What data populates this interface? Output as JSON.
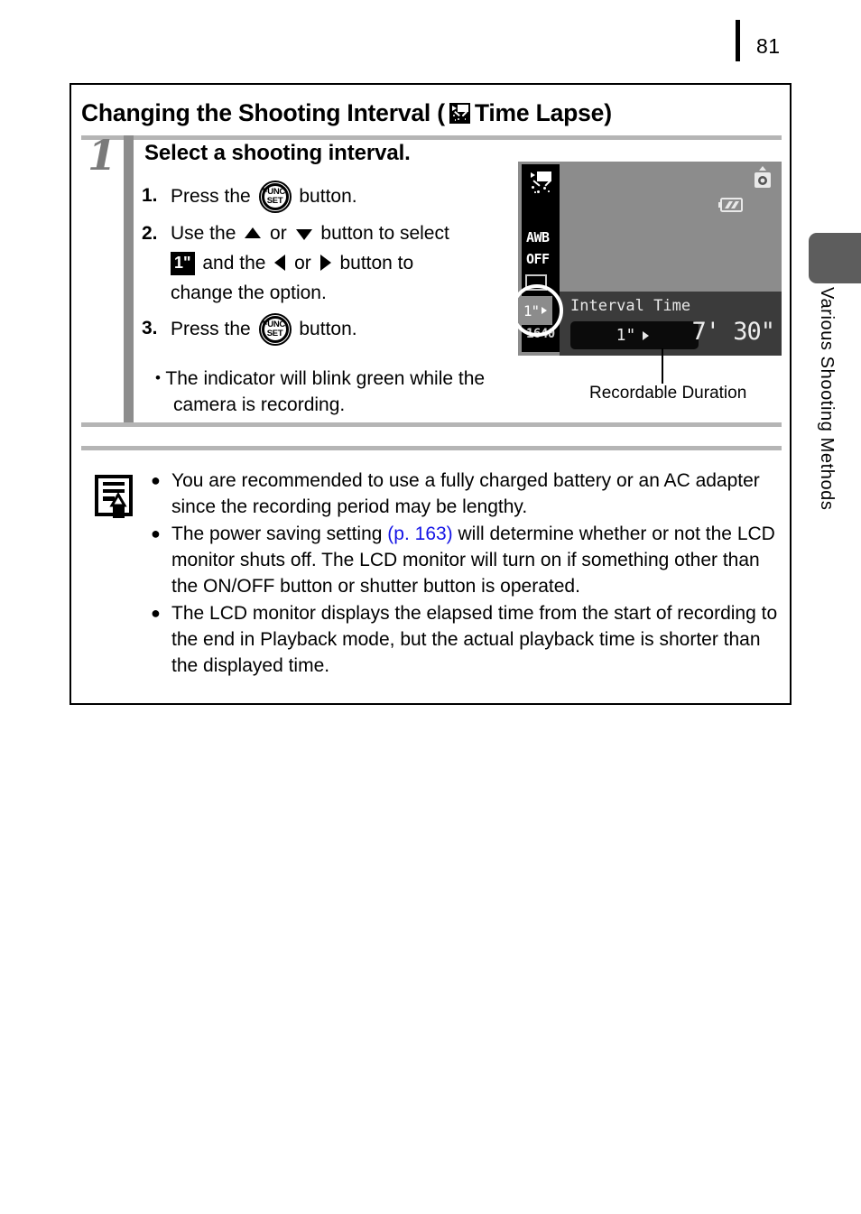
{
  "page": {
    "number": "81"
  },
  "side_tab": {
    "label": "Various Shooting Methods"
  },
  "section": {
    "title_before": "Changing the Shooting Interval (",
    "icon": "time-lapse-icon",
    "title_after": " Time Lapse)"
  },
  "step": {
    "number": "1",
    "heading": "Select a shooting interval.",
    "items": [
      {
        "index": "1.",
        "parts": [
          {
            "type": "text",
            "value": "Press the "
          },
          {
            "type": "icon",
            "value": "func-set-button"
          },
          {
            "type": "text",
            "value": " button."
          }
        ],
        "plain": "Press the FUNC./SET button."
      },
      {
        "index": "2.",
        "parts": [
          {
            "type": "text",
            "value": "Use the "
          },
          {
            "type": "icon",
            "value": "arrow-up"
          },
          {
            "type": "text",
            "value": " or "
          },
          {
            "type": "icon",
            "value": "arrow-down"
          },
          {
            "type": "text",
            "value": " button to select "
          },
          {
            "type": "tile",
            "value": "1\""
          },
          {
            "type": "text",
            "value": " and the "
          },
          {
            "type": "icon",
            "value": "arrow-left"
          },
          {
            "type": "text",
            "value": " or "
          },
          {
            "type": "icon",
            "value": "arrow-right"
          },
          {
            "type": "text",
            "value": " button to change the option."
          }
        ],
        "plain": "Use the up or down button to select 1\" and the left or right button to change the option."
      },
      {
        "index": "3.",
        "parts": [
          {
            "type": "text",
            "value": "Press the "
          },
          {
            "type": "icon",
            "value": "func-set-button"
          },
          {
            "type": "text",
            "value": " button."
          }
        ],
        "plain": "Press the FUNC./SET button."
      }
    ],
    "bullet": "The indicator will blink green while the camera is recording.",
    "fragments": {
      "press_the": "Press the ",
      "button_period": " button.",
      "use_the": "Use the ",
      "or": " or ",
      "button_to_select": " button to select ",
      "and_the": " and the ",
      "button_to_change": " button to",
      "change_the_option": "change the option.",
      "sec_tile": "1\"",
      "func_top": "FUNC.",
      "func_bottom": "SET"
    }
  },
  "lcd": {
    "sidebar": {
      "white_balance": "AWB",
      "flash": "OFF",
      "interval": "1\"",
      "resolution": "1640"
    },
    "panel_label": "Interval Time",
    "panel_value": "1\"",
    "duration": "7' 30\"",
    "highlight_chip": "1\"",
    "icons": [
      "time-lapse-icon",
      "camera-shutter-icon",
      "battery-icon",
      "drive-mode-icon"
    ]
  },
  "callout": {
    "label": "Recordable Duration"
  },
  "note": {
    "icon": "memo-pencil-icon",
    "items": [
      {
        "segments": [
          {
            "type": "text",
            "value": "You are recommended to use a fully charged battery or an AC adapter since the recording period may be lengthy."
          }
        ],
        "plain": "You are recommended to use a fully charged battery or an AC adapter since the recording period may be lengthy."
      },
      {
        "segments": [
          {
            "type": "text",
            "value": "The power saving setting "
          },
          {
            "type": "link",
            "value": "(p. 163)"
          },
          {
            "type": "text",
            "value": " will determine whether or not the LCD monitor shuts off. The LCD monitor will turn on if something other than the ON/OFF button or shutter button is operated."
          }
        ],
        "plain": "The power saving setting (p. 163) will determine whether or not the LCD monitor shuts off. The LCD monitor will turn on if something other than the ON/OFF button or shutter button is operated.",
        "link_text": "(p. 163)",
        "before_link": "The power saving setting ",
        "after_link": " will determine whether or not the LCD monitor shuts off. The LCD monitor will turn on if something other than the ON/OFF button or shutter button is operated."
      },
      {
        "segments": [
          {
            "type": "text",
            "value": "The LCD monitor displays the elapsed time from the start of recording to the end in Playback mode, but the actual playback time is shorter than the displayed time."
          }
        ],
        "plain": "The LCD monitor displays the elapsed time from the start of recording to the end in Playback mode, but the actual playback time is shorter than the displayed time."
      }
    ],
    "bullet_glyph": "●"
  },
  "colors": {
    "link": "#1414e6",
    "rule": "#b5b5b5",
    "step_bar": "#8d8d8d",
    "step_number": "#7a7a7a",
    "tab": "#5d5d5d",
    "lcd_body": "#8c8c8c",
    "lcd_panel": "#3b3b3b"
  }
}
